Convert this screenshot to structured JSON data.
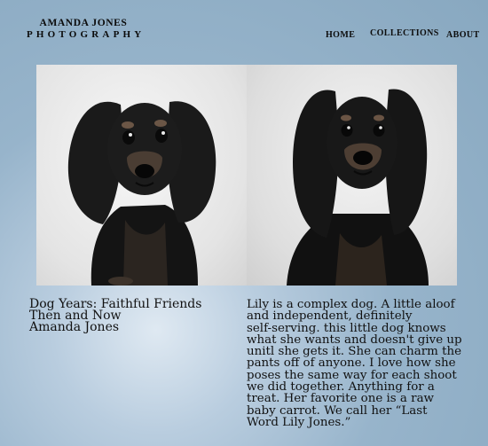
{
  "brand": {
    "name": "AMANDA JONES",
    "subtitle": "PHOTOGRAPHY"
  },
  "nav": {
    "home": "HOME",
    "collections": "COLLECTIONS",
    "about": "ABOUT"
  },
  "photos": {
    "left_icon": "dachshund-puppy-photo",
    "right_icon": "dachshund-adult-photo"
  },
  "caption": {
    "title_line1": "Dog Years: Faithful Friends",
    "title_line2": "Then and Now",
    "author": "Amanda Jones"
  },
  "story": {
    "lines": [
      "Lily is a complex dog. A little aloof",
      "and independent, definitely",
      "self-serving. this little dog knows",
      "what she wants and doesn't give up",
      "unitl she gets it. She can charm the",
      "pants off of anyone. I love how she",
      "poses the same way for each shoot",
      "we did together. Anything for a",
      "treat. Her favorite one is a raw",
      "baby carrot. We call her “Last",
      "Word Lily Jones.”"
    ]
  }
}
